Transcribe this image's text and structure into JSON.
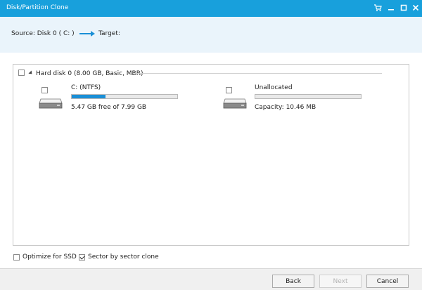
{
  "window": {
    "title": "Disk/Partition Clone",
    "title_bg": "#18a0dc",
    "accent": "#1a8fd6"
  },
  "header": {
    "source_label": "Source:  Disk 0 ( C: )",
    "target_label": "Target:"
  },
  "disk": {
    "label": "Hard disk 0 (8.00 GB, Basic, MBR)",
    "checked": false,
    "partitions": [
      {
        "name": "C: (NTFS)",
        "info": "5.47 GB free of 7.99 GB",
        "used_fraction": 0.32,
        "checked": false
      },
      {
        "name": "Unallocated",
        "info": "Capacity: 10.46 MB",
        "used_fraction": 0.0,
        "checked": false
      }
    ]
  },
  "options": {
    "optimize_ssd": {
      "label": "Optimize for SSD",
      "checked": false
    },
    "sector_clone": {
      "label": "Sector by sector clone",
      "checked": true
    }
  },
  "buttons": {
    "back": "Back",
    "next": "Next",
    "cancel": "Cancel"
  }
}
